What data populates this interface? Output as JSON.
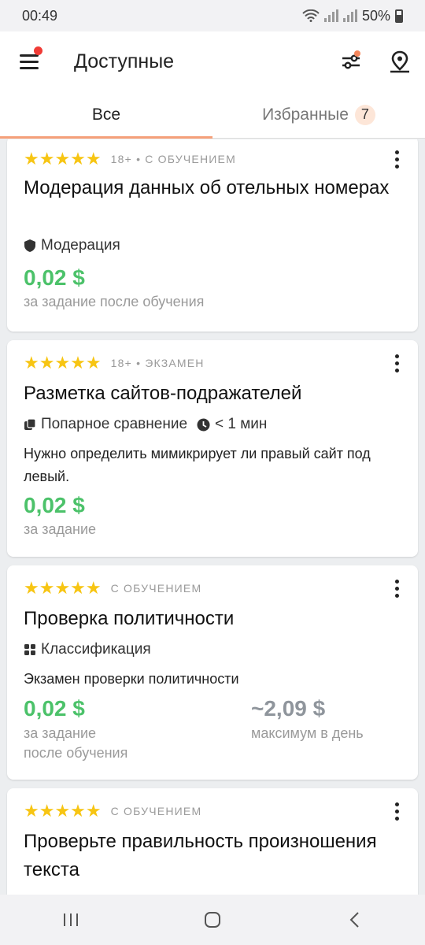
{
  "status_bar": {
    "time": "00:49",
    "battery": "50%"
  },
  "app_bar": {
    "title": "Доступные"
  },
  "tabs": [
    {
      "label": "Все",
      "active": true
    },
    {
      "label": "Избранные",
      "count": "7",
      "active": false
    }
  ],
  "colors": {
    "accent": "#f5a07a",
    "price": "#4cc26a",
    "star": "#f7c513",
    "notification": "#f03b36"
  },
  "tasks": [
    {
      "stars": "★★★★★",
      "meta": "18+ • С ОБУЧЕНИЕМ",
      "title": "Модерация данных об отельных номерах",
      "tag": "Модерация",
      "tag_icon": "shield-icon",
      "price": "0,02 $",
      "price_note": "за задание после обучения"
    },
    {
      "stars": "★★★★★",
      "meta": "18+ • ЭКЗАМЕН",
      "title": "Разметка сайтов-подражателей",
      "tag": "Попарное сравнение",
      "tag_icon": "pages-icon",
      "duration": "< 1 мин",
      "description": "Нужно определить мимикрирует ли правый сайт под левый.",
      "price": "0,02 $",
      "price_note": "за задание"
    },
    {
      "stars": "★★★★★",
      "meta": "С ОБУЧЕНИЕМ",
      "title": "Проверка политичности",
      "tag": "Классификация",
      "tag_icon": "grid-icon",
      "description": "Экзамен проверки политичности",
      "price": "0,02 $",
      "price_note_1": "за задание",
      "price_note_2": "после обучения",
      "max_price": "~2,09 $",
      "max_note": "максимум в день"
    },
    {
      "stars": "★★★★★",
      "meta": "С ОБУЧЕНИЕМ",
      "title": "Проверьте правильность произношения текста"
    }
  ]
}
